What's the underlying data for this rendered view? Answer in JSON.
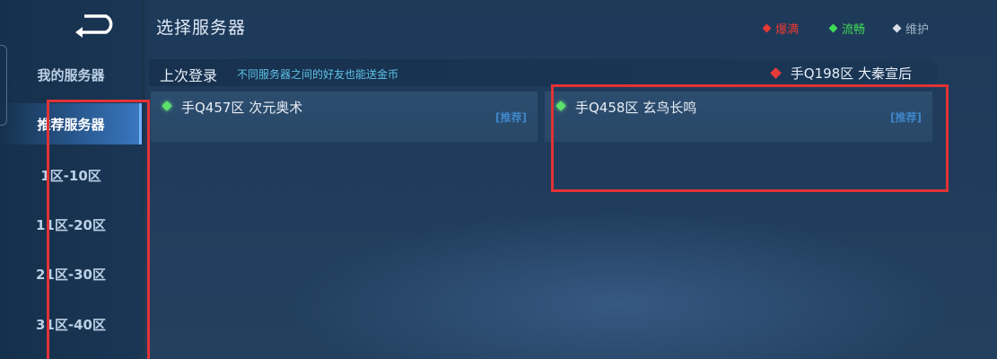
{
  "header": {
    "title": "选择服务器"
  },
  "legend": [
    {
      "label": "爆满",
      "color": "#e53935"
    },
    {
      "label": "流畅",
      "color": "#3fdc55"
    },
    {
      "label": "维护",
      "color": "#d8dee6"
    }
  ],
  "sidebar": {
    "items": [
      {
        "label": "我的服务器"
      },
      {
        "label": "推荐服务器"
      },
      {
        "label": "1区-10区"
      },
      {
        "label": "11区-20区"
      },
      {
        "label": "21区-30区"
      },
      {
        "label": "31区-40区"
      }
    ],
    "active_index": 1
  },
  "last_login": {
    "title": "上次登录",
    "tip": "不同服务器之间的好友也能送金币",
    "server": "手Q198区 大秦宣后",
    "status_color": "#e33b3b"
  },
  "servers": [
    {
      "name": "手Q457区 次元奥术",
      "tag": "[推荐]",
      "status_color": "#5ee36a"
    },
    {
      "name": "手Q458区 玄鸟长鸣",
      "tag": "[推荐]",
      "status_color": "#5ee36a"
    }
  ]
}
